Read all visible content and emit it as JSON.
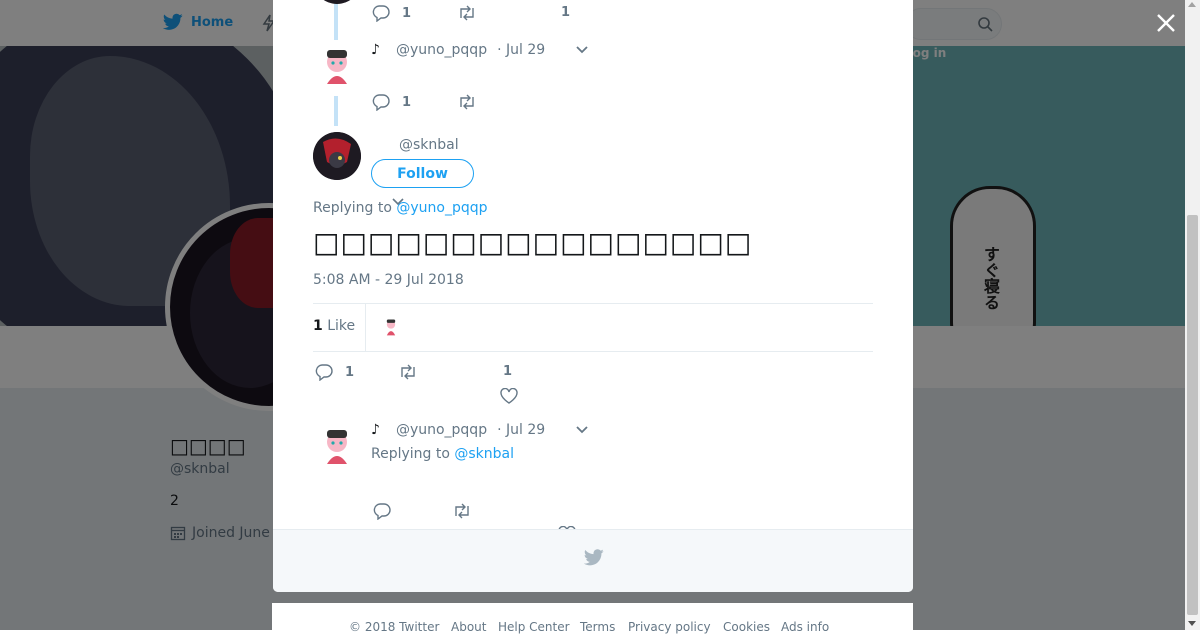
{
  "top_nav": {
    "home_label": "Home",
    "login_label": "Log in"
  },
  "banner": {
    "kana_text": "すぐ寝る"
  },
  "profile": {
    "display_name": "□□□□",
    "handle": "@sknbal",
    "count": "2",
    "joined": "Joined June"
  },
  "modal": {
    "tweet_a": {
      "reply_count": "1",
      "like_count": "1"
    },
    "tweet_b": {
      "name": "♪",
      "handle": "@yuno_pqqp",
      "date": "· Jul 29",
      "reply_count": "1"
    },
    "main": {
      "handle": "@sknbal",
      "follow_label": "Follow",
      "replying_label": "Replying to",
      "replying_handle": "@yuno_pqqp",
      "text": "□□□□□□□□□□□□□□□□",
      "timestamp": "5:08 AM - 29 Jul 2018",
      "likes_count": "1",
      "likes_label": "Like",
      "reply_count": "1",
      "like_count": "1"
    },
    "reply": {
      "name": "♪",
      "handle": "@yuno_pqqp",
      "date": "· Jul 29",
      "replying_label": "Replying to",
      "replying_handle": "@sknbal"
    }
  },
  "footer": {
    "copyright": "© 2018 Twitter",
    "about": "About",
    "help": "Help Center",
    "terms": "Terms",
    "privacy": "Privacy policy",
    "cookies": "Cookies",
    "ads": "Ads info"
  },
  "colors": {
    "accent": "#1da1f2",
    "muted": "#657786",
    "overlay": "rgba(0,0,0,0.5)"
  }
}
